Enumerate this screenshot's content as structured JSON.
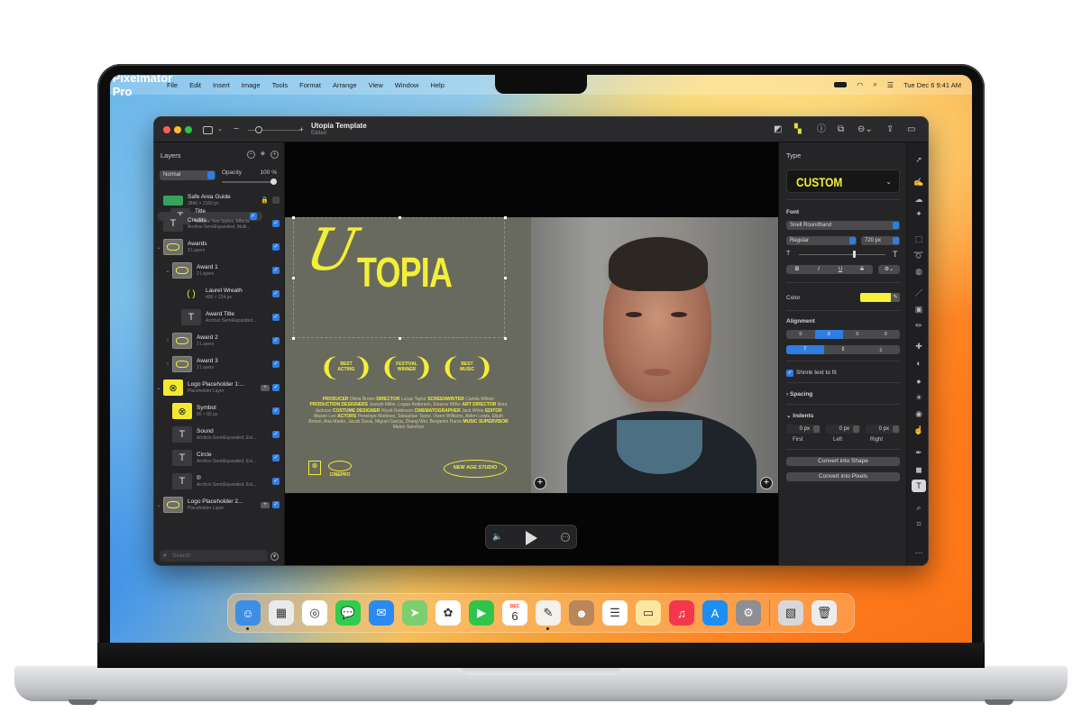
{
  "menubar": {
    "apple": "",
    "app_name": "Pixelmator Pro",
    "items": [
      "File",
      "Edit",
      "Insert",
      "Image",
      "Tools",
      "Format",
      "Arrange",
      "View",
      "Window",
      "Help"
    ],
    "clock": "Tue Dec 6  9:41 AM",
    "status_icons": [
      "battery-icon",
      "wifi-icon",
      "search-icon",
      "control-center-icon"
    ]
  },
  "window": {
    "title": "Utopia Template",
    "subtitle": "Edited",
    "zoom_minus": "−",
    "zoom_plus": "+"
  },
  "layers": {
    "heading": "Layers",
    "blend_mode": "Normal",
    "opacity_label": "Opacity",
    "opacity_value": "100 %",
    "opacity_fraction": 1.0,
    "search_placeholder": "Search",
    "rows": [
      {
        "title": "Safe Area Guide",
        "sub": "3840 × 2160 px",
        "thumb": "green",
        "indent": 0,
        "chevron": "",
        "checked": false,
        "locked": true,
        "badge": false
      },
      {
        "title": "Title",
        "sub": "Multiple Text Styles, Effects",
        "thumb": "text",
        "indent": 0,
        "chevron": "",
        "checked": true,
        "selected": true
      },
      {
        "title": "Credits",
        "sub": "Archivo SemiExpanded, Multi...",
        "thumb": "text",
        "indent": 0,
        "chevron": "",
        "checked": true
      },
      {
        "title": "Awards",
        "sub": "3 Layers",
        "thumb": "folder",
        "indent": 0,
        "chevron": "⌄",
        "checked": true
      },
      {
        "title": "Award 1",
        "sub": "2 Layers",
        "thumb": "folder",
        "indent": 1,
        "chevron": "⌄",
        "checked": true
      },
      {
        "title": "Laurel Wreath",
        "sub": "400 × 224 px",
        "thumb": "wreath",
        "indent": 2,
        "chevron": "",
        "checked": true
      },
      {
        "title": "Award Title",
        "sub": "Archivo SemiExpanded...",
        "thumb": "text",
        "indent": 2,
        "chevron": "",
        "checked": true
      },
      {
        "title": "Award 2",
        "sub": "2 Layers",
        "thumb": "folder",
        "indent": 1,
        "chevron": "›",
        "checked": true
      },
      {
        "title": "Award 3",
        "sub": "2 Layers",
        "thumb": "folder",
        "indent": 1,
        "chevron": "›",
        "checked": true
      },
      {
        "title": "Logo Placeholder 1:...",
        "sub": "Placeholder Layer",
        "thumb": "yellow",
        "indent": 0,
        "chevron": "⌄",
        "checked": true,
        "badge": true
      },
      {
        "title": "Symbol",
        "sub": "86 × 82 px",
        "thumb": "yellow",
        "indent": 1,
        "chevron": "",
        "checked": true
      },
      {
        "title": "Sound",
        "sub": "Archivo SemiExpanded, Ext...",
        "thumb": "text",
        "indent": 1,
        "chevron": "",
        "checked": true
      },
      {
        "title": "Circle",
        "sub": "Archivo SemiExpanded, Ext...",
        "thumb": "text",
        "indent": 1,
        "chevron": "",
        "checked": true
      },
      {
        "title": "®",
        "sub": "Archivo SemiExpanded, Ext...",
        "thumb": "text",
        "indent": 1,
        "chevron": "",
        "checked": true
      },
      {
        "title": "Logo Placeholder 2...",
        "sub": "Placeholder Layer",
        "thumb": "folder",
        "indent": 0,
        "chevron": "⌄",
        "checked": true,
        "badge": true
      }
    ]
  },
  "canvas": {
    "title_script": "U",
    "title_main": "TOPIA",
    "awards": [
      [
        "BEST",
        "ACTING"
      ],
      [
        "FESTIVAL",
        "WINNER"
      ],
      [
        "BEST",
        "MUSIC"
      ]
    ],
    "credits": [
      {
        "role": "PRODUCER",
        "name": "Olivia Brown"
      },
      {
        "role": "DIRECTOR",
        "name": "Lucas Taylor"
      },
      {
        "role": "SCREENWRITER",
        "name": "Camila Wilson"
      },
      {
        "role": "PRODUCTION DESIGNERS",
        "name": "Joseph Miller, Logan Anderson, Eleanor Miller"
      },
      {
        "role": "ART DIRECTOR",
        "name": "Nora Jackson"
      },
      {
        "role": "COSTUME DESIGNER",
        "name": "Wyatt Robinson"
      },
      {
        "role": "CINEMATOGRAPHER",
        "name": "Jack White"
      },
      {
        "role": "EDITOR",
        "name": "Mason Lee"
      },
      {
        "role": "ACTORS",
        "name": "Penelope Martinez, Sebastian Taylor, Owen Williams, Aiden Lewis, Elijah Brown, Aria Martin, Jacob Davis, Miguel Garcia, Zhang Wei, Benjamin Harris"
      },
      {
        "role": "MUSIC SUPERVISOR",
        "name": "Mateo Sanchez"
      }
    ],
    "logo_1": "⊗",
    "logo_2": "CINEPRO",
    "studio": "NEW AGE STUDIO",
    "add_symbol": "+"
  },
  "player": {
    "volume_icon": "🔈",
    "more_icon": "⋯"
  },
  "inspector": {
    "heading": "Type",
    "style_name": "CUSTOM",
    "font_label": "Font",
    "font_family": "Snell Roundhand",
    "font_style": "Regular",
    "font_size": "720 px",
    "size_slider_fraction": 0.62,
    "format_buttons": [
      "B",
      "I",
      "U",
      "S"
    ],
    "color_label": "Color",
    "color_value": "#f6f23a",
    "alignment_label": "Alignment",
    "h_align": [
      "≡",
      "≡",
      "≡",
      "≡"
    ],
    "h_align_selected": 1,
    "v_align": [
      "⤒",
      "⇕",
      "⤓"
    ],
    "v_align_selected": 0,
    "shrink_label": "Shrink text to fit",
    "shrink_checked": true,
    "spacing_label": "Spacing",
    "indents_label": "Indents",
    "indents": [
      {
        "value": "0 px",
        "label": "First"
      },
      {
        "value": "0 px",
        "label": "Left"
      },
      {
        "value": "0 px",
        "label": "Right"
      }
    ],
    "convert_shape": "Convert into Shape",
    "convert_pixels": "Convert into Pixels"
  },
  "tools": [
    "arrange-tool",
    "style-tool",
    "color-adjust-tool",
    "effects-tool",
    "select-tool",
    "lasso-tool",
    "quick-select-tool",
    "paint-tool",
    "fill-tool",
    "erase-tool",
    "retouch-tool",
    "distort-tool",
    "blur-tool",
    "lighten-tool",
    "sharpen-tool",
    "smudge-tool",
    "pen-tool",
    "shape-tool",
    "type-tool",
    "zoom-tool",
    "crop-tool",
    "more-tool"
  ],
  "dock": {
    "apps": [
      {
        "name": "Finder",
        "color": "#3d8fe6",
        "glyph": "☺",
        "running": true
      },
      {
        "name": "Launchpad",
        "color": "#eaeaec",
        "glyph": "▦",
        "running": false
      },
      {
        "name": "Safari",
        "color": "#ffffff",
        "glyph": "◎",
        "running": false
      },
      {
        "name": "Messages",
        "color": "#2fcd4d",
        "glyph": "💬",
        "running": false
      },
      {
        "name": "Mail",
        "color": "#2a8af2",
        "glyph": "✉",
        "running": false
      },
      {
        "name": "Maps",
        "color": "#7ccf6e",
        "glyph": "➤",
        "running": false
      },
      {
        "name": "Photos",
        "color": "#ffffff",
        "glyph": "✿",
        "running": false
      },
      {
        "name": "FaceTime",
        "color": "#30c54a",
        "glyph": "▶",
        "running": false
      },
      {
        "name": "Calendar",
        "color": "#ffffff",
        "glyph": "6",
        "running": false,
        "month": "DEC"
      },
      {
        "name": "Pixelmator Pro",
        "color": "#f4f0ea",
        "glyph": "✎",
        "running": true
      },
      {
        "name": "Contacts",
        "color": "#b9875a",
        "glyph": "☻",
        "running": false
      },
      {
        "name": "Reminders",
        "color": "#ffffff",
        "glyph": "☰",
        "running": false
      },
      {
        "name": "Notes",
        "color": "#fbe7a0",
        "glyph": "▭",
        "running": false
      },
      {
        "name": "Music",
        "color": "#f5364f",
        "glyph": "♫",
        "running": false
      },
      {
        "name": "App Store",
        "color": "#1c8ef5",
        "glyph": "A",
        "running": false
      },
      {
        "name": "System Settings",
        "color": "#8e8e93",
        "glyph": "⚙",
        "running": false
      },
      {
        "name": "Downloads",
        "color": "#d7d7d9",
        "glyph": "▧",
        "running": false
      },
      {
        "name": "Trash",
        "color": "#ececee",
        "glyph": "🗑",
        "running": false
      }
    ]
  }
}
